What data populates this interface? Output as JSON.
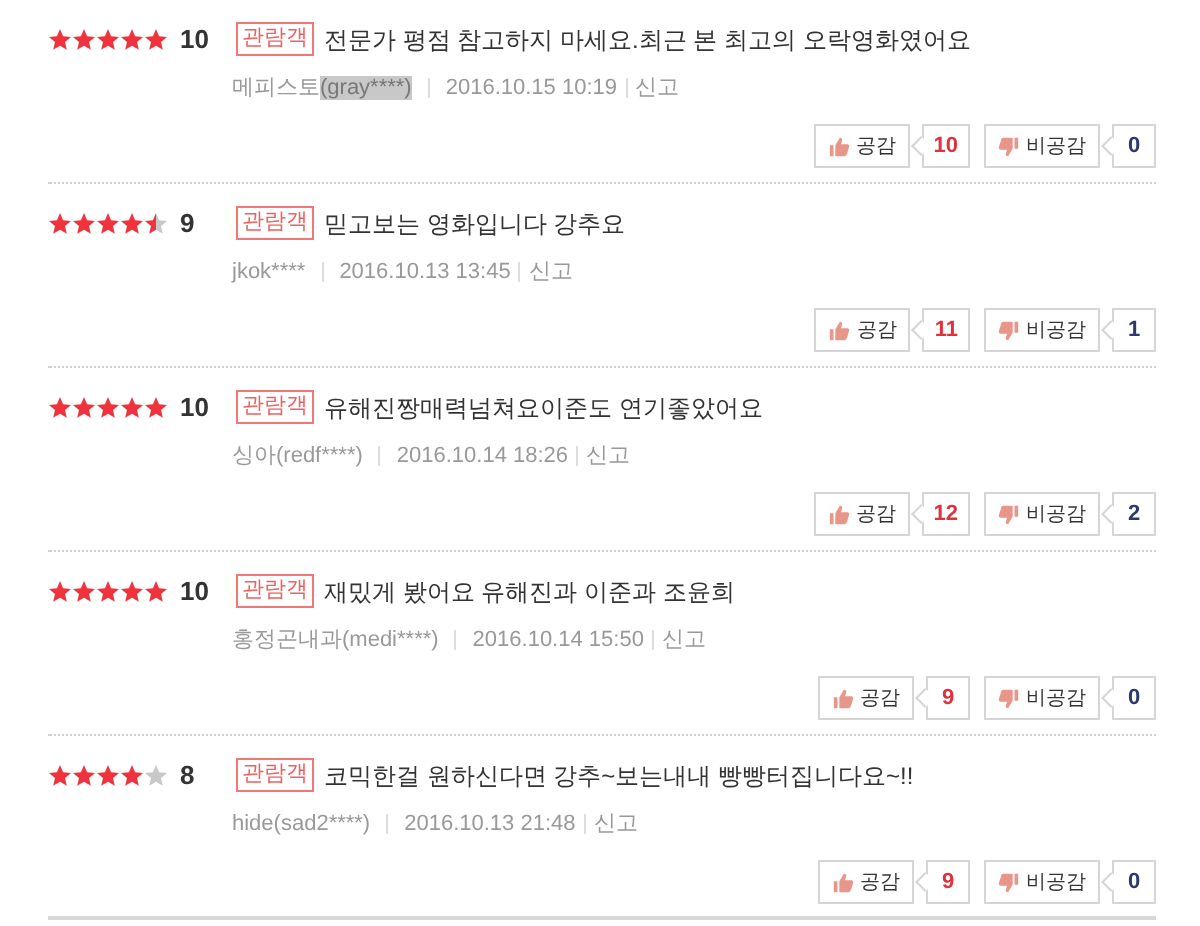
{
  "reviews": [
    {
      "stars": 5,
      "score": "10",
      "badge": "관람객",
      "text": "전문가 평점 참고하지 마세요.최근 본 최고의 오락영화였어요",
      "author": "메피스토",
      "highlight": "(gray****)",
      "date": "2016.10.15 10:19",
      "report": "신고",
      "like_label": "공감",
      "likes": "10",
      "dislike_label": "비공감",
      "dislikes": "0"
    },
    {
      "stars": 4.5,
      "score": "9",
      "badge": "관람객",
      "text": "믿고보는 영화입니다 강추요",
      "author": "jkok****",
      "date": "2016.10.13 13:45",
      "report": "신고",
      "like_label": "공감",
      "likes": "11",
      "dislike_label": "비공감",
      "dislikes": "1"
    },
    {
      "stars": 5,
      "score": "10",
      "badge": "관람객",
      "text": "유해진짱매력넘쳐요이준도 연기좋았어요",
      "author": "싱아(redf****)",
      "date": "2016.10.14 18:26",
      "report": "신고",
      "like_label": "공감",
      "likes": "12",
      "dislike_label": "비공감",
      "dislikes": "2"
    },
    {
      "stars": 5,
      "score": "10",
      "badge": "관람객",
      "text": "재밌게 봤어요 유해진과 이준과 조윤희",
      "author": "홍정곤내과(medi****)",
      "date": "2016.10.14 15:50",
      "report": "신고",
      "like_label": "공감",
      "likes": "9",
      "dislike_label": "비공감",
      "dislikes": "0"
    },
    {
      "stars": 4,
      "score": "8",
      "badge": "관람객",
      "text": "코믹한걸 원하신다면 강추~보는내내 빵빵터집니다요~!!",
      "author": "hide(sad2****)",
      "date": "2016.10.13 21:48",
      "report": "신고",
      "like_label": "공감",
      "likes": "9",
      "dislike_label": "비공감",
      "dislikes": "0"
    }
  ]
}
